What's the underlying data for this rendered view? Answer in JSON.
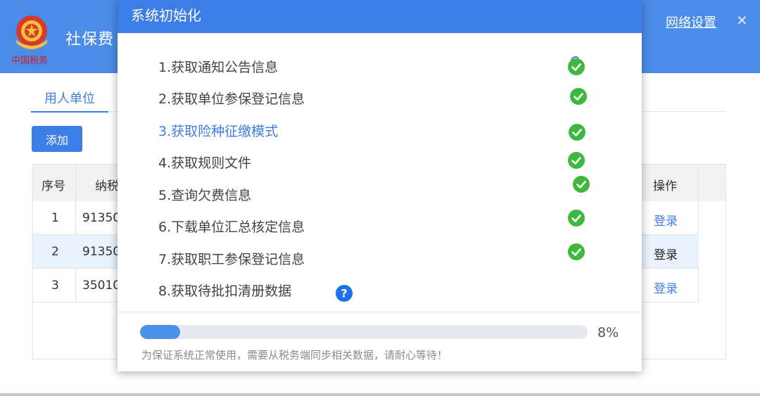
{
  "app": {
    "title": "社保费",
    "network_settings": "网络设置",
    "close_glyph": "✕",
    "colors": {
      "header": "#4a8ce8",
      "accent": "#3d7ee6"
    }
  },
  "tabs": [
    {
      "label": "用人单位",
      "active": true
    }
  ],
  "toolbar": {
    "add_label": "添加"
  },
  "table": {
    "headers": {
      "index": "序号",
      "taxpayer": "纳税",
      "action": "操作"
    },
    "rows": [
      {
        "index": "1",
        "taxpayer": "91350",
        "action": "登录",
        "selected": false
      },
      {
        "index": "2",
        "taxpayer": "91350",
        "action": "登录",
        "selected": true
      },
      {
        "index": "3",
        "taxpayer": "35010",
        "action": "登录",
        "selected": false
      }
    ]
  },
  "dialog": {
    "title": "系统初始化",
    "steps": [
      {
        "label": "1.获取通知公告信息",
        "status": "done"
      },
      {
        "label": "2.获取单位参保登记信息",
        "status": "done"
      },
      {
        "label": "3.获取险种征缴模式",
        "status": "done",
        "highlight": true
      },
      {
        "label": "4.获取规则文件",
        "status": "done"
      },
      {
        "label": "5.查询欠费信息",
        "status": "done"
      },
      {
        "label": "6.下载单位汇总核定信息",
        "status": "done"
      },
      {
        "label": "7.获取职工参保登记信息",
        "status": "done"
      },
      {
        "label": "8.获取待批扣清册数据",
        "status": "unknown"
      }
    ],
    "progress": {
      "value": 0.08,
      "label": "8%"
    },
    "hint": "为保证系统正常使用，需要从税务端同步相关数据，请耐心等待！",
    "icons": {
      "done": "check-circle-icon",
      "unknown": "question-circle-icon"
    },
    "colors": {
      "done": "#3fb83f",
      "unknown": "#1a73e8",
      "progress": "#4a90e8"
    }
  }
}
